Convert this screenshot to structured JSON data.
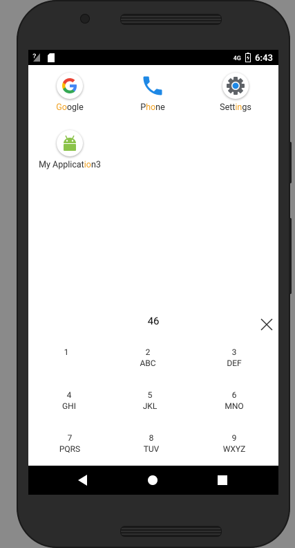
{
  "status_bar": {
    "signal_icon": "no-signal-icon",
    "sim_icon": "sim-card-icon",
    "network_label": "4G",
    "battery_icon": "battery-charging-icon",
    "time": "6:43"
  },
  "apps": [
    {
      "name_pre": "",
      "name_hl": "Go",
      "name_post": "ogle",
      "icon": "google-icon"
    },
    {
      "name_pre": "P",
      "name_hl": "ho",
      "name_post": "ne",
      "icon": "phone-icon"
    },
    {
      "name_pre": "Sett",
      "name_hl": "in",
      "name_post": "gs",
      "icon": "settings-gear-icon"
    },
    {
      "name_pre": "My Applicat",
      "name_hl": "io",
      "name_post": "n3",
      "icon": "android-icon"
    }
  ],
  "search": {
    "query": "46",
    "clear_icon": "close-icon"
  },
  "dialpad": [
    {
      "num": "1",
      "letters": ""
    },
    {
      "num": "2",
      "letters": "ABC"
    },
    {
      "num": "3",
      "letters": "DEF"
    },
    {
      "num": "4",
      "letters": "GHI"
    },
    {
      "num": "5",
      "letters": "JKL"
    },
    {
      "num": "6",
      "letters": "MNO"
    },
    {
      "num": "7",
      "letters": "PQRS"
    },
    {
      "num": "8",
      "letters": "TUV"
    },
    {
      "num": "9",
      "letters": "WXYZ"
    }
  ],
  "nav": {
    "back_icon": "back-icon",
    "home_icon": "home-icon",
    "recents_icon": "recents-icon"
  },
  "colors": {
    "highlight": "#f0a020",
    "phone_blue": "#1e88e5",
    "android_green": "#8bc34a"
  }
}
